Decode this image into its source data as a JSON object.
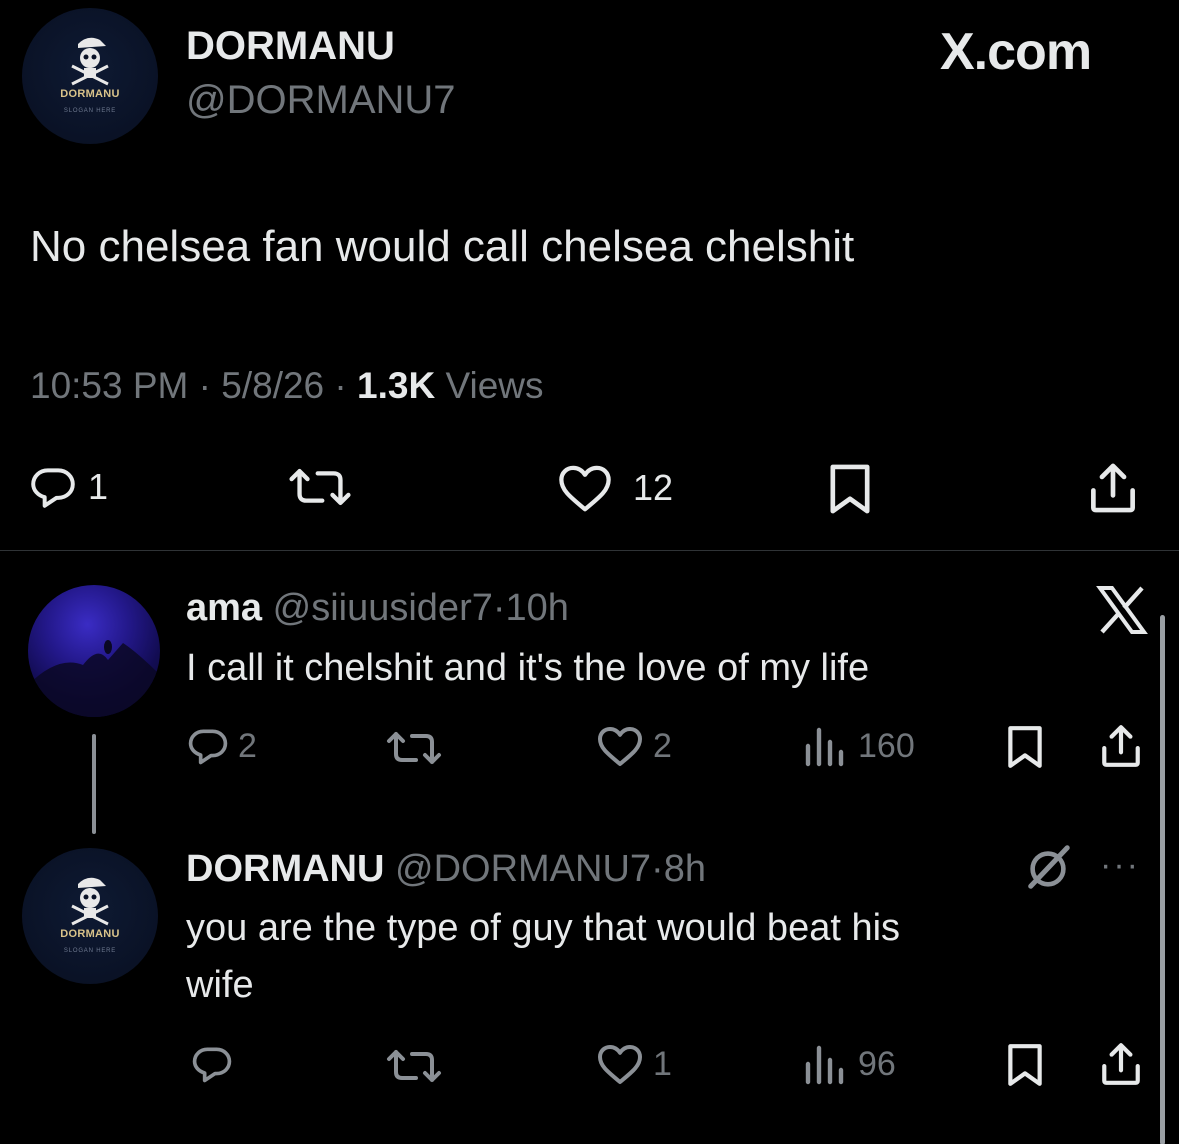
{
  "site_label": "X.com",
  "main_tweet": {
    "display_name": "DORMANU",
    "handle": "@DORMANU7",
    "avatar_logo_text": "DORMANU",
    "avatar_logo_sub": "SLOGAN HERE",
    "text": "No chelsea fan would call chelsea chelshit",
    "time": "10:53 PM",
    "separator": "·",
    "date": "5/8/26",
    "views_count": "1.3K",
    "views_label": "Views",
    "replies": "1",
    "likes": "12",
    "icons": [
      "reply-icon",
      "retweet-icon",
      "like-icon",
      "bookmark-icon",
      "share-icon"
    ]
  },
  "replies": [
    {
      "display_name": "ama",
      "handle": "@siiuusider7",
      "separator": "·",
      "age": "10h",
      "text": "I call it chelshit and it's the love of my life",
      "replies": "2",
      "likes": "2",
      "views": "160",
      "badge_icon": "x-logo-icon"
    },
    {
      "display_name": "DORMANU",
      "handle": "@DORMANU7",
      "separator": "·",
      "age": "8h",
      "text_line1": "you are the type of guy that would beat his",
      "text_line2": "wife",
      "replies": "",
      "likes": "1",
      "views": "96",
      "avatar_logo_text": "DORMANU",
      "avatar_logo_sub": "SLOGAN HERE",
      "more_label": "···"
    }
  ],
  "colors": {
    "background": "#000000",
    "text": "#e7e9ea",
    "muted": "#71767b",
    "divider": "#2f3336"
  }
}
